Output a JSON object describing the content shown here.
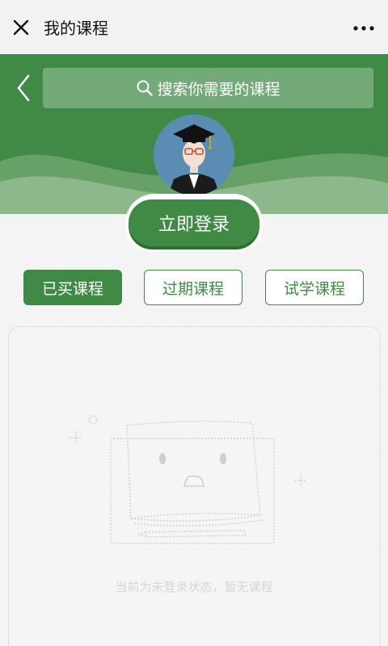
{
  "header": {
    "title": "我的课程",
    "close_icon": "close-icon",
    "more_icon": "more-horizontal-icon"
  },
  "banner": {
    "back_icon": "chevron-left-icon",
    "search_placeholder": "搜索你需要的课程",
    "search_icon": "search-icon",
    "avatar": "graduate-avatar",
    "login_label": "立即登录"
  },
  "tabs": [
    {
      "label": "已买课程",
      "active": true
    },
    {
      "label": "过期课程",
      "active": false
    },
    {
      "label": "试学课程",
      "active": false
    }
  ],
  "empty_state": {
    "message": "当前为未登录状态，暂无课程"
  },
  "colors": {
    "primary_green": "#3f8a44",
    "background": "#f4f4f4"
  }
}
